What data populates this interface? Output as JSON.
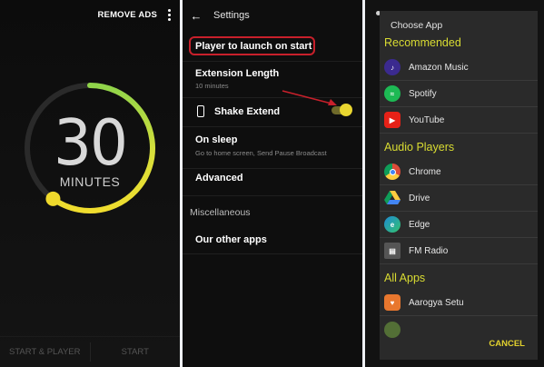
{
  "timer": {
    "remove_ads": "REMOVE ADS",
    "value": "30",
    "unit": "MINUTES",
    "progress": 0.6,
    "accent_color": "#e9d630",
    "bottom_buttons": [
      "START & PLAYER",
      "START"
    ]
  },
  "settings": {
    "title": "Settings",
    "items": [
      {
        "title": "Player to launch on start",
        "subtitle": ""
      },
      {
        "title": "Extension Length",
        "subtitle": "10 minutes"
      },
      {
        "title": "Shake Extend",
        "subtitle": "",
        "toggle": true
      },
      {
        "title": "On sleep",
        "subtitle": "Go to home screen, Send Pause Broadcast"
      },
      {
        "title": "Advanced",
        "subtitle": ""
      },
      {
        "title": "Our other apps",
        "subtitle": ""
      }
    ],
    "section_label": "Miscellaneous",
    "highlight_color": "#c8202b"
  },
  "chooser": {
    "title": "Choose App",
    "categories": [
      "Recommended",
      "Audio Players",
      "All Apps"
    ],
    "recommended": [
      {
        "label": "Amazon Music",
        "icon": "amazon-music-icon",
        "color": "#3b2a8f"
      },
      {
        "label": "Spotify",
        "icon": "spotify-icon",
        "color": "#1db954"
      },
      {
        "label": "YouTube",
        "icon": "youtube-icon",
        "color": "#e62117"
      }
    ],
    "audio_players": [
      {
        "label": "Chrome",
        "icon": "chrome-icon",
        "color": "#dd4b39"
      },
      {
        "label": "Drive",
        "icon": "drive-icon",
        "color": "#0f9d58"
      },
      {
        "label": "Edge",
        "icon": "edge-icon",
        "color": "#1e8bd3"
      },
      {
        "label": "FM Radio",
        "icon": "radio-icon",
        "color": "#555555"
      }
    ],
    "all_apps": [
      {
        "label": "Aarogya Setu",
        "icon": "aarogya-setu-icon",
        "color": "#e8772e"
      }
    ],
    "cancel_label": "CANCEL"
  }
}
